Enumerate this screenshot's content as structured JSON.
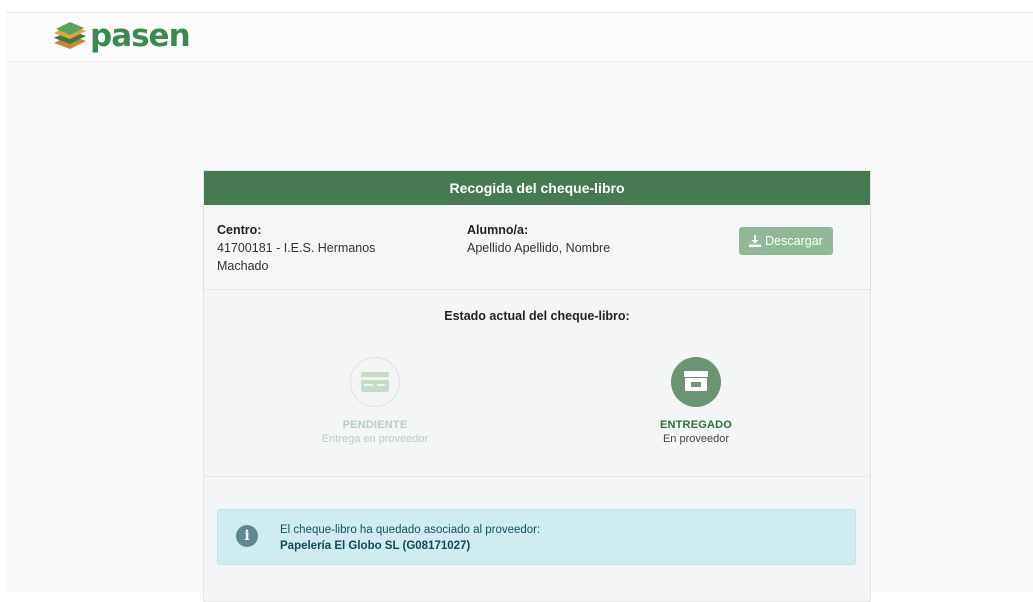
{
  "brand": {
    "name": "pasen"
  },
  "card": {
    "title": "Recogida del cheque-libro",
    "centro": {
      "label": "Centro:",
      "value": "41700181 - I.E.S. Hermanos Machado"
    },
    "alumno": {
      "label": "Alumno/a:",
      "value": "Apellido Apellido, Nombre"
    },
    "download_label": "Descargar"
  },
  "status": {
    "title": "Estado actual del cheque-libro:",
    "steps": [
      {
        "title": "PENDIENTE",
        "subtitle": "Entrega en proveedor",
        "icon": "card-icon",
        "state": "inactive"
      },
      {
        "title": "ENTREGADO",
        "subtitle": "En proveedor",
        "icon": "store-icon",
        "state": "active"
      }
    ]
  },
  "alert": {
    "message": "El cheque-libro ha quedado asociado al proveedor:",
    "provider": "Papelería El Globo SL (G08171027)",
    "icon": "info-icon"
  },
  "colors": {
    "primary": "#467a52",
    "button": "#8fba95",
    "alert_bg": "#d1ecf1",
    "alert_text": "#0c5460"
  }
}
